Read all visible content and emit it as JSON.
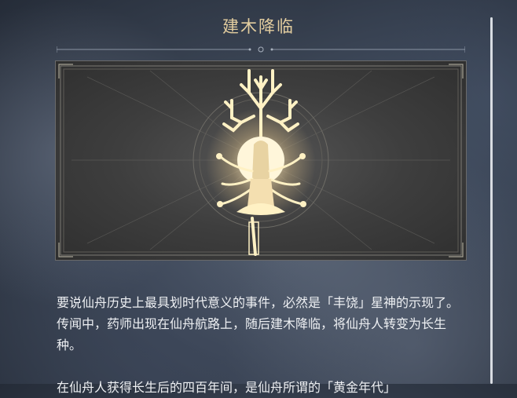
{
  "panel": {
    "title": "建木降临",
    "paragraphs": [
      "要说仙舟历史上最具划时代意义的事件，必然是「丰饶」星神的示现了。传闻中，药师出现在仙舟航路上，随后建木降临，将仙舟人转变为长生种。",
      "在仙舟人获得长生后的四百年间，是仙舟所谓的「黄金年代」"
    ]
  },
  "artwork": {
    "subject": "abundance-deity-emblem-icon"
  },
  "colors": {
    "title_gold": "#e3cd9f",
    "text": "#eef0f3",
    "glow": "#fff2c9"
  }
}
